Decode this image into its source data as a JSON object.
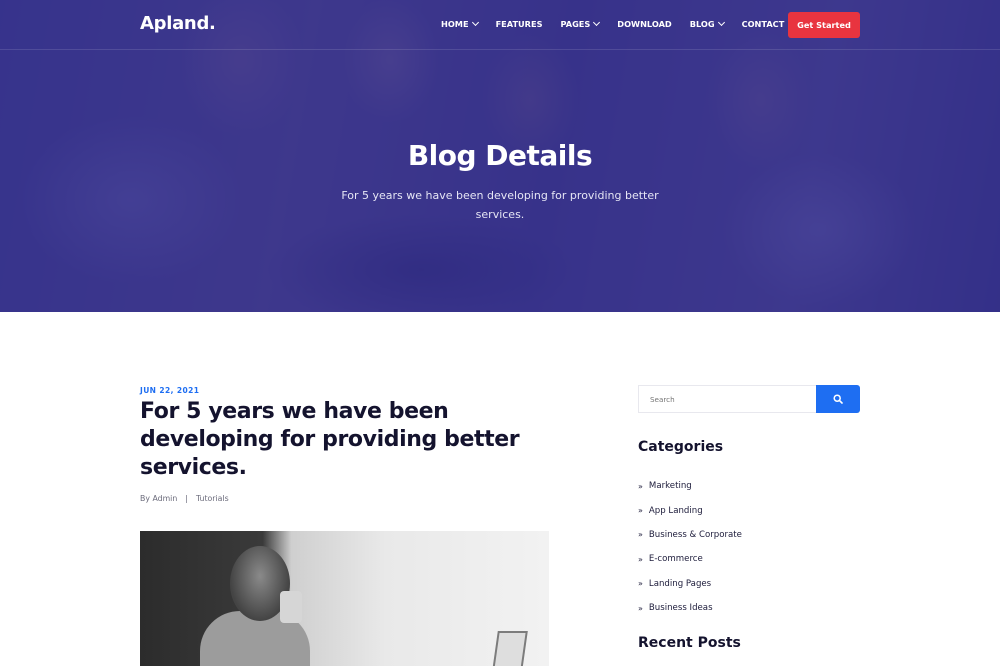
{
  "brand": {
    "logo": "Apland."
  },
  "nav": {
    "items": [
      {
        "label": "HOME",
        "dropdown": true
      },
      {
        "label": "FEATURES",
        "dropdown": false
      },
      {
        "label": "PAGES",
        "dropdown": true
      },
      {
        "label": "DOWNLOAD",
        "dropdown": false
      },
      {
        "label": "BLOG",
        "dropdown": true
      },
      {
        "label": "CONTACT",
        "dropdown": false
      }
    ],
    "cta_label": "Get Started"
  },
  "hero": {
    "title": "Blog Details",
    "subtitle": "For 5 years we have been developing for providing better services."
  },
  "post": {
    "date": "JUN 22, 2021",
    "title": "For 5 years we have been developing for providing better services.",
    "author": "By Admin",
    "separator": "|",
    "category": "Tutorials"
  },
  "sidebar": {
    "search": {
      "placeholder": "Search",
      "button_icon": "search-icon"
    },
    "categories_title": "Categories",
    "categories": [
      "Marketing",
      "App Landing",
      "Business & Corporate",
      "E-commerce",
      "Landing Pages",
      "Business Ideas"
    ],
    "recent_posts_title": "Recent Posts"
  },
  "colors": {
    "hero_overlay": "#28248c",
    "cta": "#e8343f",
    "accent": "#1e6ef2",
    "heading": "#14132e"
  }
}
